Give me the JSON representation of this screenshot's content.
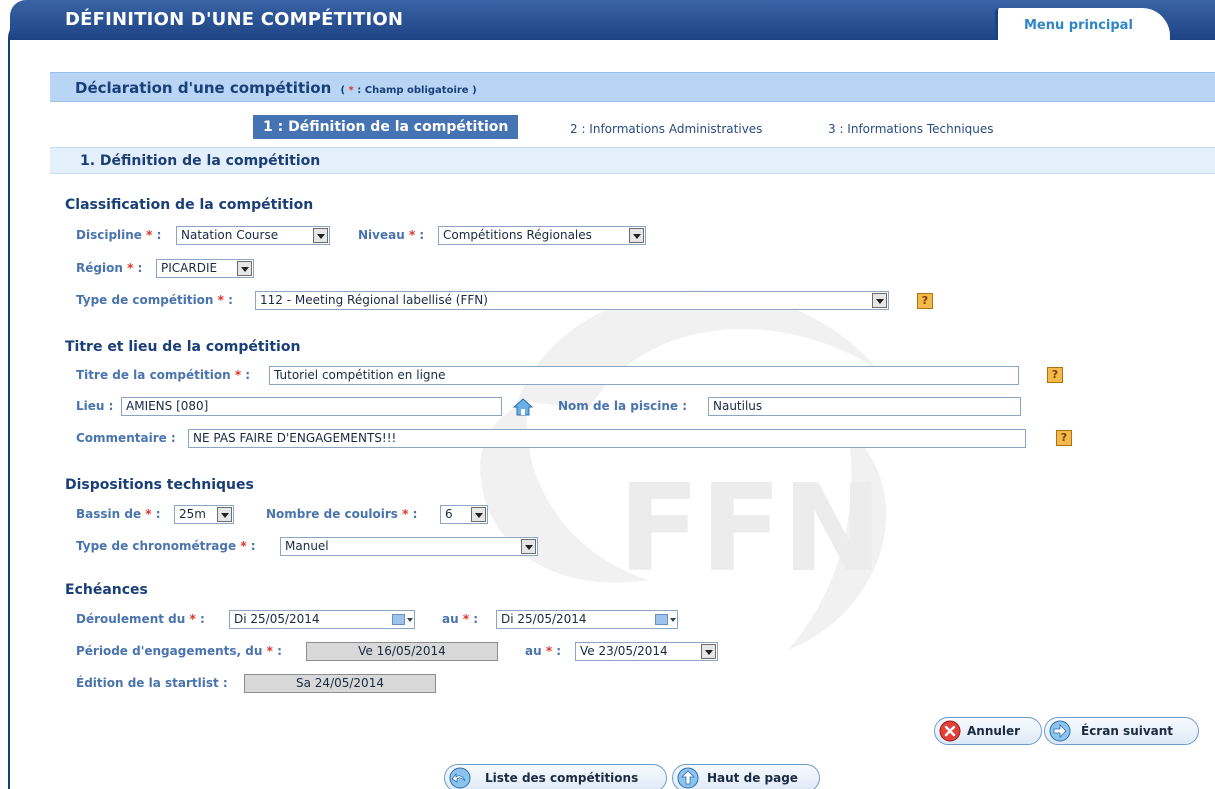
{
  "header": {
    "title": "DÉFINITION D'UNE COMPÉTITION",
    "menu_label": "Menu principal"
  },
  "declaration": {
    "title": "Déclaration d'une compétition",
    "required_note_star": "*",
    "required_note_text": ": Champ obligatoire )",
    "required_note_open": "("
  },
  "steps": [
    {
      "label": "1 : Définition de la compétition",
      "active": true
    },
    {
      "label": "2 : Informations Administratives",
      "active": false
    },
    {
      "label": "3 : Informations Techniques",
      "active": false
    }
  ],
  "section": {
    "title": "1. Définition de la compétition"
  },
  "classification": {
    "heading": "Classification de la compétition",
    "discipline_label": "Discipline",
    "discipline_value": "Natation Course",
    "niveau_label": "Niveau",
    "niveau_value": "Compétitions Régionales",
    "region_label": "Région",
    "region_value": "PICARDIE",
    "type_label": "Type de compétition",
    "type_value": "112 - Meeting Régional labellisé (FFN)"
  },
  "titre_lieu": {
    "heading": "Titre et lieu de la compétition",
    "titre_label": "Titre de la compétition",
    "titre_value": "Tutoriel compétition en ligne",
    "lieu_label": "Lieu :",
    "lieu_value": "AMIENS [080]",
    "piscine_label": "Nom de la piscine :",
    "piscine_value": "Nautilus",
    "commentaire_label": "Commentaire :",
    "commentaire_value": "NE PAS FAIRE D'ENGAGEMENTS!!!"
  },
  "dispositions": {
    "heading": "Dispositions techniques",
    "bassin_label": "Bassin de",
    "bassin_value": "25m",
    "couloirs_label": "Nombre de couloirs",
    "couloirs_value": "6",
    "chrono_label": "Type de chronométrage",
    "chrono_value": "Manuel"
  },
  "echeances": {
    "heading": "Echéances",
    "deroulement_label": "Déroulement du",
    "deroulement_from": "Di 25/05/2014",
    "au_label": "au",
    "deroulement_to": "Di 25/05/2014",
    "periode_label": "Période d'engagements, du",
    "periode_from": "Ve 16/05/2014",
    "periode_to": "Ve 23/05/2014",
    "startlist_label": "Édition de la startlist :",
    "startlist_value": "Sa 24/05/2014"
  },
  "common": {
    "star": "*",
    "colon": ":",
    "help": "?"
  },
  "actions": {
    "annuler": "Annuler",
    "suivant": "Écran suivant",
    "liste": "Liste des compétitions",
    "haut": "Haut de page"
  },
  "watermark_text": "FFN",
  "colors": {
    "header": "#1c4485",
    "band": "#b8d5f5",
    "accent": "#4673b3",
    "required": "#e0322a"
  }
}
